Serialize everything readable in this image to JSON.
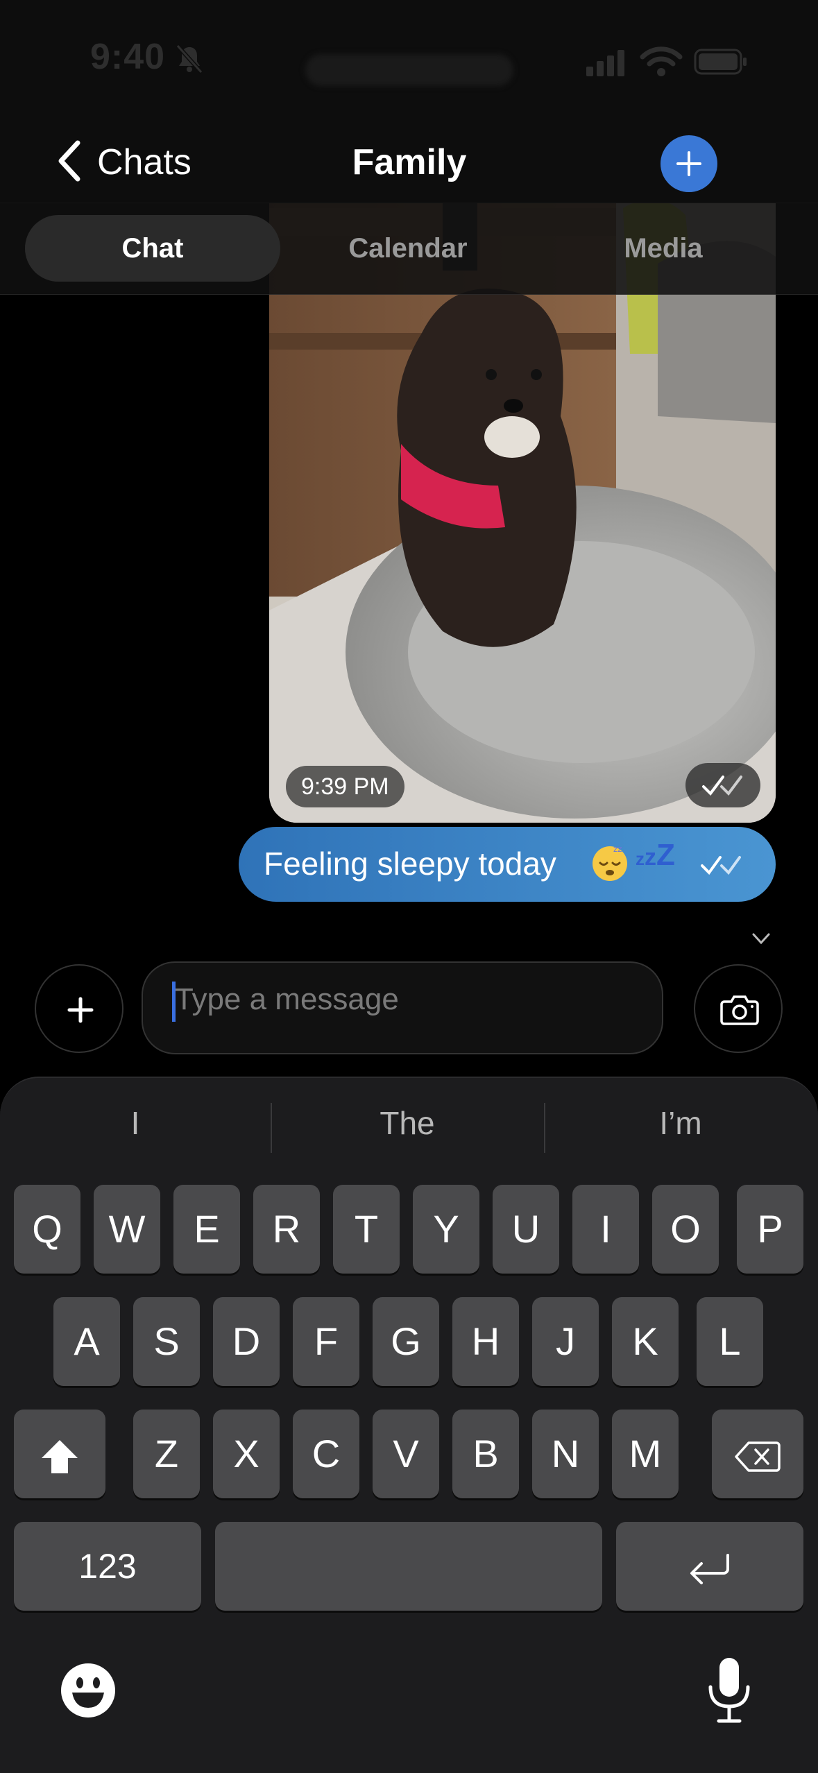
{
  "status_bar": {
    "time": "9:40"
  },
  "header": {
    "back_label": "Chats",
    "title": "Family"
  },
  "tabs": [
    {
      "label": "Chat",
      "active": true
    },
    {
      "label": "Calendar",
      "active": false
    },
    {
      "label": "Media",
      "active": false
    }
  ],
  "messages": [
    {
      "type": "photo",
      "time": "9:39 PM",
      "status": "read"
    },
    {
      "type": "text",
      "text": "Feeling sleepy today",
      "emoji": "sleeping-face",
      "status": "read"
    }
  ],
  "composer": {
    "placeholder": "Type a message"
  },
  "keyboard": {
    "suggestions": [
      "I",
      "The",
      "I’m"
    ],
    "row1": [
      "Q",
      "W",
      "E",
      "R",
      "T",
      "Y",
      "U",
      "I",
      "O",
      "P"
    ],
    "row2": [
      "A",
      "S",
      "D",
      "F",
      "G",
      "H",
      "J",
      "K",
      "L"
    ],
    "row3": [
      "Z",
      "X",
      "C",
      "V",
      "B",
      "N",
      "M"
    ],
    "numbers_label": "123"
  },
  "colors": {
    "accent": "#3a78d6",
    "bubble_start": "#2f73b8",
    "bubble_end": "#4a95d2",
    "background": "#000000",
    "keyboard": "#1c1c1e"
  }
}
